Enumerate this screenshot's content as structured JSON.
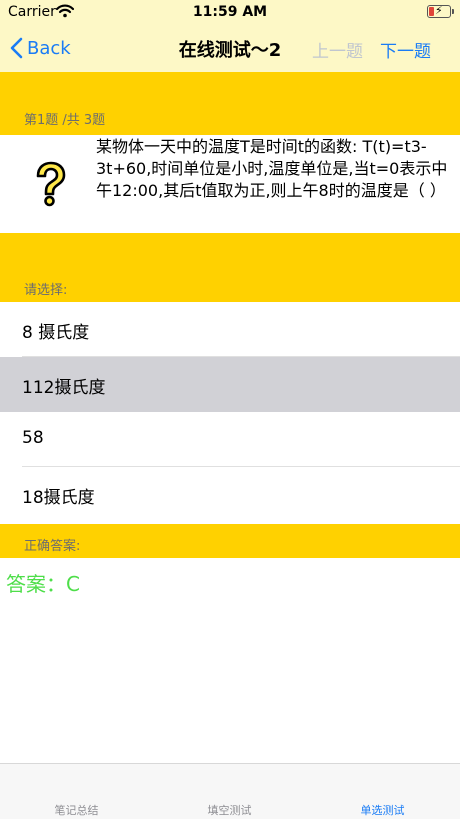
{
  "status_bar": {
    "carrier": "Carrier",
    "time": "11:59 AM"
  },
  "nav": {
    "back_label": "Back",
    "title": "在线测试～2",
    "prev_label": "上一题",
    "next_label": "下一题"
  },
  "question": {
    "counter": "第1题 /共 3题",
    "text": "某物体一天中的温度T是时间t的函数: T(t)=t3-3t+60,时间单位是小时,温度单位是,当t=0表示中午12:00,其后t值取为正,则上午8时的温度是（   ）"
  },
  "choices": {
    "label": "请选择:",
    "options": [
      {
        "label": "8 摄氏度",
        "selected": false
      },
      {
        "label": "112摄氏度",
        "selected": true
      },
      {
        "label": "58",
        "selected": false
      },
      {
        "label": "18摄氏度",
        "selected": false
      }
    ]
  },
  "answer": {
    "label": "正确答案:",
    "text": "答案：C"
  },
  "tabs": [
    {
      "label": "笔记总结",
      "active": false
    },
    {
      "label": "填空测试",
      "active": false
    },
    {
      "label": "单选测试",
      "active": true
    }
  ],
  "colors": {
    "accent": "#1a7cf5",
    "band": "#ffd100",
    "nav_background": "#fdf8c6",
    "answer_text": "#4ede4a",
    "selected_row": "#d1d1d6"
  }
}
